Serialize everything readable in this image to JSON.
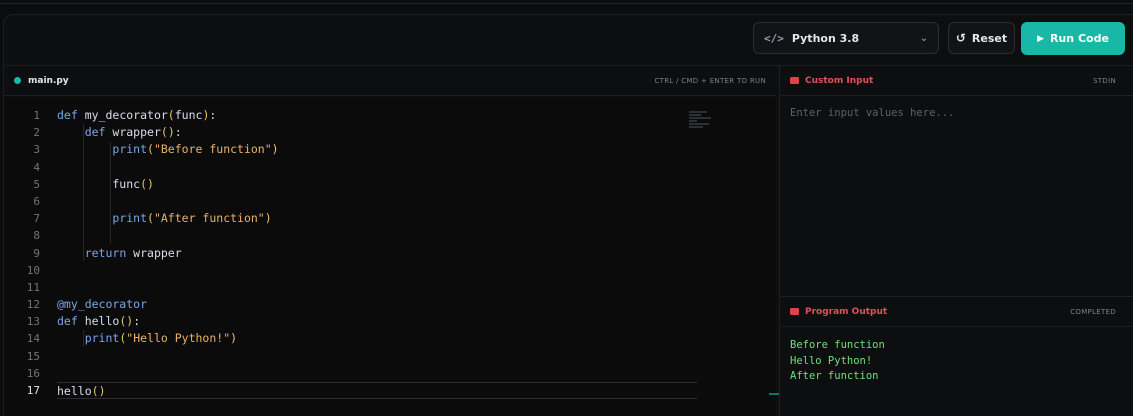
{
  "toolbar": {
    "language": "Python 3.8",
    "language_icon": "</>",
    "reset_label": "Reset",
    "run_label": "Run Code",
    "accent_color": "#19b8a6"
  },
  "editor": {
    "file_name": "main.py",
    "run_hint": "CTRL / CMD + ENTER TO RUN",
    "active_line": 17,
    "line_numbers": [
      "1",
      "2",
      "3",
      "4",
      "5",
      "6",
      "7",
      "8",
      "9",
      "10",
      "11",
      "12",
      "13",
      "14",
      "15",
      "16",
      "17"
    ],
    "code_lines": [
      "def my_decorator(func):",
      "    def wrapper():",
      "        print(\"Before function\")",
      "",
      "        func()",
      "",
      "        print(\"After function\")",
      "",
      "    return wrapper",
      "",
      "",
      "@my_decorator",
      "def hello():",
      "    print(\"Hello Python!\")",
      "",
      "",
      "hello()"
    ]
  },
  "input_panel": {
    "title": "Custom Input",
    "tag": "STDIN",
    "placeholder": "Enter input values here...",
    "value": ""
  },
  "output_panel": {
    "title": "Program Output",
    "status": "COMPLETED",
    "lines": [
      "Before function",
      "Hello Python!",
      "After function"
    ],
    "output_color": "#6fe07a"
  }
}
